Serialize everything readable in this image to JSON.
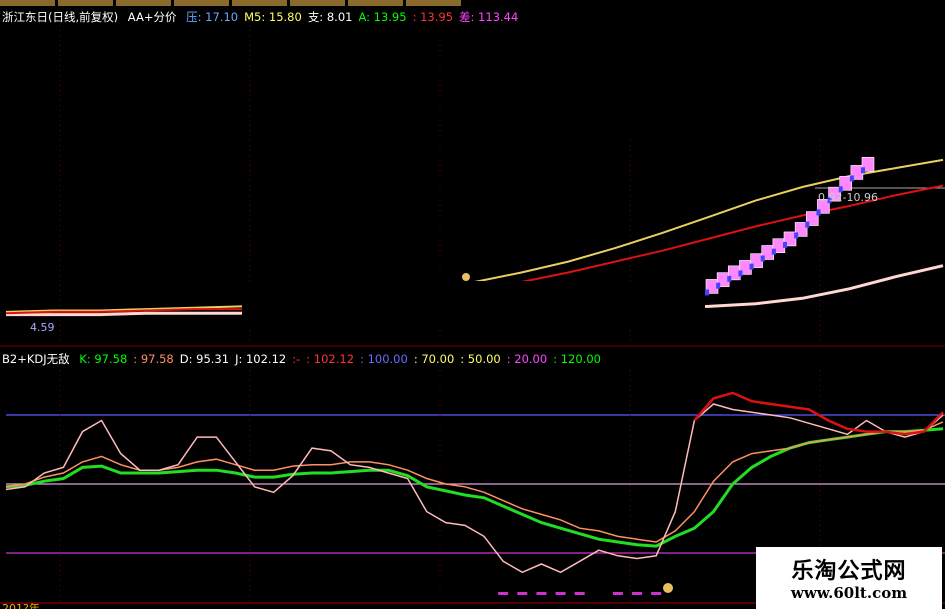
{
  "price_header": {
    "stock": "浙江东日(日线,前复权)",
    "indicator": "AA+分价",
    "items": [
      {
        "label": "压:",
        "value": "17.10",
        "color": "#6aa7ff"
      },
      {
        "label": "M5:",
        "value": "15.80",
        "color": "#ffff66"
      },
      {
        "label": "支:",
        "value": "8.01",
        "color": "#ffffff"
      },
      {
        "label": "A:",
        "value": "13.95",
        "color": "#00ff00"
      },
      {
        "label": ":",
        "value": "13.95",
        "color": "#ff3333"
      },
      {
        "label": "差:",
        "value": "113.44",
        "color": "#ff44ff"
      }
    ]
  },
  "kdj_header": {
    "name": "B2+KDJ无敌",
    "items": [
      {
        "label": "K:",
        "value": "97.58",
        "color": "#00ff00"
      },
      {
        "label": ":",
        "value": "97.58",
        "color": "#ff9060"
      },
      {
        "label": "D:",
        "value": "95.31",
        "color": "#ffffff"
      },
      {
        "label": "J:",
        "value": "102.12",
        "color": "#ffffff"
      },
      {
        "label": ":-",
        "value": "",
        "color": "#ff3333"
      },
      {
        "label": ":",
        "value": "102.12",
        "color": "#ff3333"
      },
      {
        "label": ":",
        "value": "100.00",
        "color": "#6a6aff"
      },
      {
        "label": ":",
        "value": "70.00",
        "color": "#ffff66"
      },
      {
        "label": ":",
        "value": "50.00",
        "color": "#ffff66"
      },
      {
        "label": ":",
        "value": "20.00",
        "color": "#ff44ff"
      },
      {
        "label": ":",
        "value": "120.00",
        "color": "#00ff00"
      }
    ]
  },
  "annotations": {
    "price_range": "0.92-10.96",
    "left_low": "4.59",
    "bottom_date": "201?年"
  },
  "watermark": {
    "title": "乐淘公式网",
    "url": "www.60lt.com"
  },
  "chart_data": [
    {
      "type": "candlestick",
      "title": "浙江东日(日线,前复权) AA+分价",
      "xlabel": "",
      "ylabel": "",
      "ylim": [
        4,
        18
      ],
      "series": [
        {
          "name": "M5",
          "color": "#e8d060",
          "values": [
            4.6,
            4.7,
            4.7,
            4.8,
            4.9,
            5.0,
            5.1,
            5.3,
            5.7,
            6.2,
            6.8,
            7.5,
            8.3,
            9.3,
            10.4,
            11.6,
            12.8,
            13.8,
            14.6,
            15.2,
            15.8
          ]
        },
        {
          "name": "支",
          "color": "#ffd8d0",
          "values": [
            4.4,
            4.4,
            4.4,
            4.5,
            4.5,
            4.5,
            4.6,
            4.6,
            4.6,
            4.7,
            4.7,
            4.7,
            4.8,
            4.8,
            4.9,
            5.0,
            5.2,
            5.6,
            6.3,
            7.2,
            8.0
          ]
        },
        {
          "name": "MA-red",
          "color": "#dd1111",
          "values": [
            4.5,
            4.6,
            4.6,
            4.7,
            4.8,
            4.8,
            4.9,
            5.0,
            5.3,
            5.7,
            6.2,
            6.8,
            7.5,
            8.3,
            9.1,
            10.0,
            10.9,
            11.7,
            12.4,
            13.2,
            13.9
          ]
        }
      ],
      "candles": [
        {
          "close": 6.4
        },
        {
          "close": 6.9
        },
        {
          "close": 7.4
        },
        {
          "close": 7.8
        },
        {
          "close": 8.3
        },
        {
          "close": 8.9
        },
        {
          "close": 9.4
        },
        {
          "close": 9.9
        },
        {
          "close": 10.6
        },
        {
          "close": 11.4
        },
        {
          "close": 12.3
        },
        {
          "close": 13.2
        },
        {
          "close": 14.0
        },
        {
          "close": 14.8
        },
        {
          "close": 15.4
        }
      ]
    },
    {
      "type": "line",
      "title": "B2+KDJ无敌",
      "xlabel": "",
      "ylabel": "",
      "ylim": [
        0,
        120
      ],
      "hlines": [
        {
          "value": 100,
          "color": "#5a5aff"
        },
        {
          "value": 50,
          "color": "#e0a0e0"
        },
        {
          "value": 0,
          "color": "#cc33cc"
        }
      ],
      "series": [
        {
          "name": "K",
          "color": "#22dd22",
          "values": [
            48,
            49,
            52,
            54,
            62,
            63,
            58,
            58,
            58,
            59,
            60,
            60,
            58,
            55,
            55,
            57,
            58,
            58,
            59,
            60,
            60,
            56,
            48,
            45,
            42,
            40,
            34,
            28,
            22,
            18,
            14,
            10,
            8,
            6,
            5,
            12,
            18,
            30,
            50,
            62,
            70,
            76,
            80,
            82,
            84,
            86,
            88,
            88,
            89,
            90
          ]
        },
        {
          "name": "D",
          "color": "#ff9060",
          "values": [
            48,
            50,
            55,
            58,
            66,
            70,
            64,
            60,
            60,
            62,
            66,
            68,
            64,
            60,
            60,
            63,
            64,
            64,
            66,
            66,
            64,
            60,
            54,
            50,
            48,
            44,
            38,
            32,
            28,
            24,
            18,
            16,
            12,
            10,
            8,
            16,
            30,
            52,
            66,
            72,
            74,
            76,
            80,
            82,
            84,
            86,
            88,
            88,
            89,
            95
          ]
        },
        {
          "name": "J",
          "color": "#ffbbbb",
          "values": [
            46,
            48,
            58,
            62,
            88,
            96,
            72,
            60,
            60,
            64,
            84,
            84,
            66,
            48,
            44,
            56,
            76,
            74,
            64,
            62,
            58,
            54,
            30,
            22,
            20,
            12,
            -6,
            -14,
            -8,
            -14,
            -6,
            2,
            -2,
            -4,
            -2,
            30,
            96,
            108,
            104,
            102,
            100,
            98,
            94,
            90,
            86,
            96,
            88,
            84,
            88,
            100
          ]
        },
        {
          "name": "J-red",
          "color": "#dd1111",
          "values": [
            null,
            null,
            null,
            null,
            null,
            null,
            null,
            null,
            null,
            null,
            null,
            null,
            null,
            null,
            null,
            null,
            null,
            null,
            null,
            null,
            null,
            null,
            null,
            null,
            null,
            null,
            null,
            null,
            null,
            null,
            null,
            null,
            null,
            null,
            null,
            null,
            96,
            112,
            116,
            110,
            108,
            106,
            104,
            96,
            90,
            88,
            88,
            86,
            88,
            102
          ]
        }
      ]
    }
  ]
}
